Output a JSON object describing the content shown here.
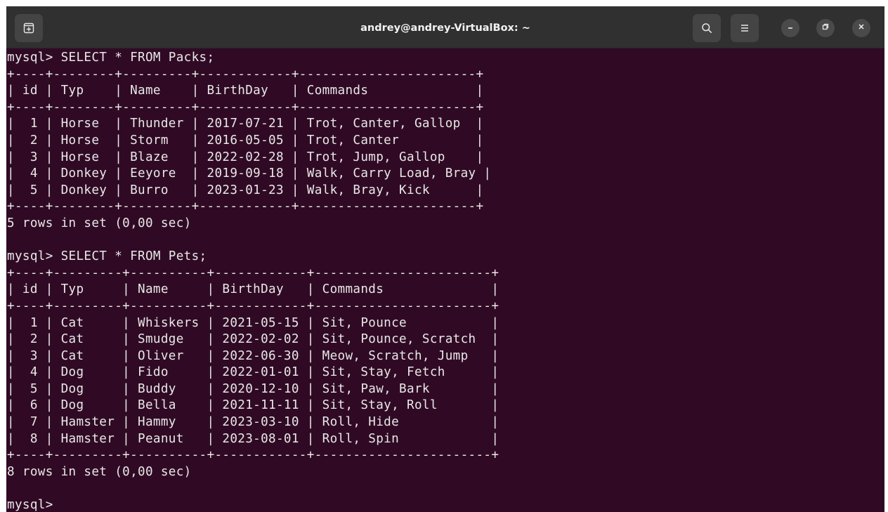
{
  "window": {
    "title": "andrey@andrey-VirtualBox: ~",
    "new_tab_icon": "new-tab-icon",
    "search_icon": "search-icon",
    "menu_icon": "hamburger-menu-icon",
    "minimize_icon": "minimize-icon",
    "restore_icon": "restore-icon",
    "close_icon": "close-icon",
    "colors": {
      "titlebar": "#303030",
      "terminal_bg": "#300a24",
      "terminal_fg": "#e8e8e8"
    }
  },
  "terminal": {
    "lines": [
      "mysql> SELECT * FROM Packs;",
      "+----+--------+---------+------------+-----------------------+",
      "| id | Typ    | Name    | BirthDay   | Commands              |",
      "+----+--------+---------+------------+-----------------------+",
      "|  1 | Horse  | Thunder | 2017-07-21 | Trot, Canter, Gallop  |",
      "|  2 | Horse  | Storm   | 2016-05-05 | Trot, Canter          |",
      "|  3 | Horse  | Blaze   | 2022-02-28 | Trot, Jump, Gallop    |",
      "|  4 | Donkey | Eeyore  | 2019-09-18 | Walk, Carry Load, Bray |",
      "|  5 | Donkey | Burro   | 2023-01-23 | Walk, Bray, Kick      |",
      "+----+--------+---------+------------+-----------------------+",
      "5 rows in set (0,00 sec)",
      "",
      "mysql> SELECT * FROM Pets;",
      "+----+---------+----------+------------+-----------------------+",
      "| id | Typ     | Name     | BirthDay   | Commands              |",
      "+----+---------+----------+------------+-----------------------+",
      "|  1 | Cat     | Whiskers | 2021-05-15 | Sit, Pounce           |",
      "|  2 | Cat     | Smudge   | 2022-02-02 | Sit, Pounce, Scratch  |",
      "|  3 | Cat     | Oliver   | 2022-06-30 | Meow, Scratch, Jump   |",
      "|  4 | Dog     | Fido     | 2022-01-01 | Sit, Stay, Fetch      |",
      "|  5 | Dog     | Buddy    | 2020-12-10 | Sit, Paw, Bark        |",
      "|  6 | Dog     | Bella    | 2021-11-11 | Sit, Stay, Roll       |",
      "|  7 | Hamster | Hammy    | 2023-03-10 | Roll, Hide            |",
      "|  8 | Hamster | Peanut   | 2023-08-01 | Roll, Spin            |",
      "+----+---------+----------+------------+-----------------------+",
      "8 rows in set (0,00 sec)",
      "",
      "mysql> "
    ]
  }
}
